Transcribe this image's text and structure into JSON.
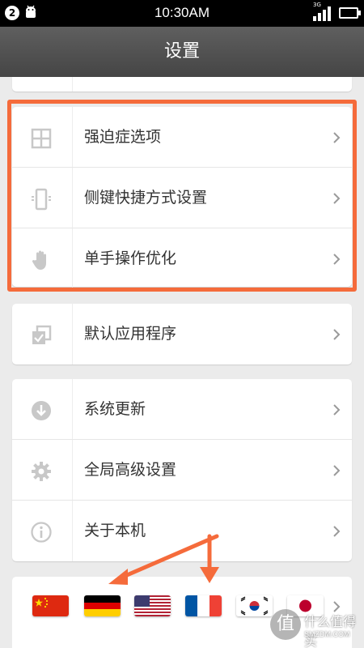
{
  "status_bar": {
    "notification_count": "2",
    "time": "10:30AM",
    "network_type": "3G"
  },
  "header": {
    "title": "设置"
  },
  "group_special": {
    "items": [
      {
        "label": "强迫症选项",
        "icon": "grid-icon"
      },
      {
        "label": "侧键快捷方式设置",
        "icon": "side-key-phone-icon"
      },
      {
        "label": "单手操作优化",
        "icon": "hand-icon"
      }
    ]
  },
  "group_apps": {
    "items": [
      {
        "label": "默认应用程序",
        "icon": "default-apps-icon"
      }
    ]
  },
  "group_system": {
    "items": [
      {
        "label": "系统更新",
        "icon": "download-icon"
      },
      {
        "label": "全局高级设置",
        "icon": "gear-icon"
      },
      {
        "label": "关于本机",
        "icon": "info-icon"
      }
    ]
  },
  "languages": [
    "china-flag",
    "germany-flag",
    "usa-flag",
    "france-flag",
    "korea-flag",
    "japan-flag"
  ],
  "watermark": {
    "main": "什么值得买",
    "sub": "SMZDM.COM",
    "badge": "值"
  },
  "colors": {
    "highlight": "#f56b3b",
    "titlebar": "#4f4f4f",
    "icon_gray": "#c8c8c8"
  }
}
